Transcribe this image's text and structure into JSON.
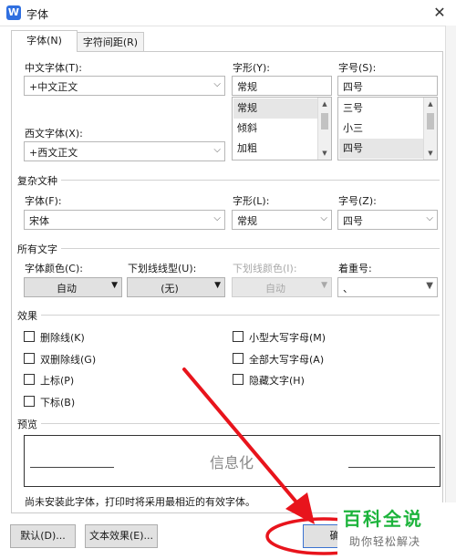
{
  "window": {
    "title": "字体",
    "app_icon": "W",
    "close_glyph": "✕"
  },
  "tabs": [
    {
      "label": "字体(N)",
      "active": true
    },
    {
      "label": "字符间距(R)",
      "active": false
    }
  ],
  "font": {
    "chinese_font_label": "中文字体(T):",
    "chinese_font_value": "+中文正文",
    "western_font_label": "西文字体(X):",
    "western_font_value": "+西文正文",
    "style_label": "字形(Y):",
    "style_value": "常规",
    "style_options": [
      "常规",
      "倾斜",
      "加粗"
    ],
    "size_label": "字号(S):",
    "size_value": "四号",
    "size_options": [
      "三号",
      "小三",
      "四号"
    ]
  },
  "complex": {
    "section": "复杂文种",
    "font_label": "字体(F):",
    "font_value": "宋体",
    "style_label": "字形(L):",
    "style_value": "常规",
    "size_label": "字号(Z):",
    "size_value": "四号"
  },
  "all_text": {
    "section": "所有文字",
    "color_label": "字体颜色(C):",
    "color_value": "自动",
    "underline_label": "下划线线型(U):",
    "underline_value": "(无)",
    "underline_color_label": "下划线颜色(I):",
    "underline_color_value": "自动",
    "emphasis_label": "着重号:",
    "emphasis_value": "、"
  },
  "effects": {
    "section": "效果",
    "left": [
      "删除线(K)",
      "双删除线(G)",
      "上标(P)",
      "下标(B)"
    ],
    "right": [
      "小型大写字母(M)",
      "全部大写字母(A)",
      "隐藏文字(H)"
    ]
  },
  "preview": {
    "section": "预览",
    "sample": "信息化",
    "note": "尚未安装此字体，打印时将采用最相近的有效字体。"
  },
  "buttons": {
    "default": "默认(D)...",
    "text_effects": "文本效果(E)...",
    "ok": "确"
  },
  "watermark": {
    "main": "百科全说",
    "sub": "助你轻松解决"
  },
  "colors": {
    "accent_arrow": "#e8141c",
    "watermark_green": "#1db43c",
    "icon_blue": "#2f6fe0"
  }
}
